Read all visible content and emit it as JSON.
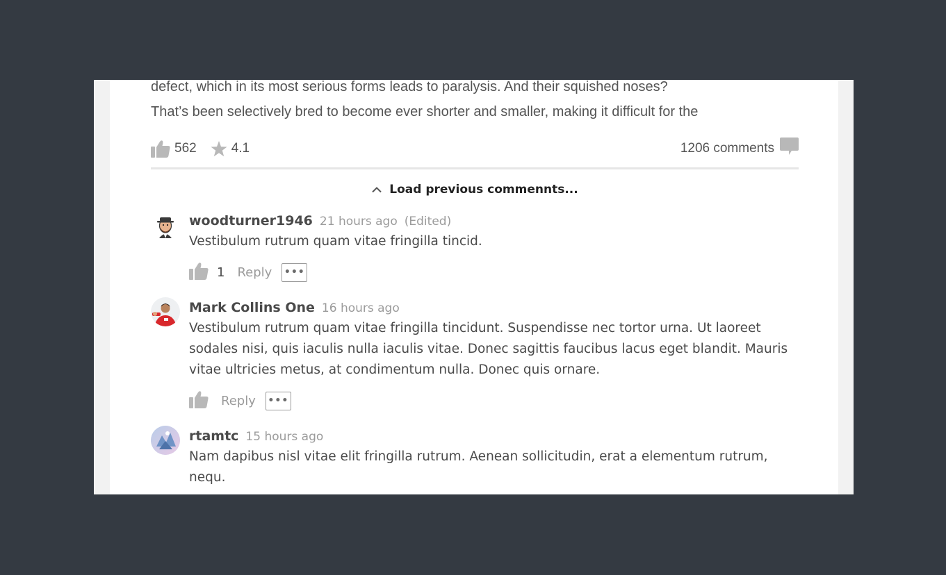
{
  "article": {
    "excerpt_lines": [
      "defect, which in its most serious forms leads to paralysis. And their squished noses?",
      "That’s been selectively bred to become ever shorter and smaller, making it difficult for the"
    ]
  },
  "stats": {
    "likes": "562",
    "rating": "4.1",
    "comments": "1206 comments"
  },
  "load_previous_label": "Load previous commennts...",
  "comments": [
    {
      "author": "woodturner1946",
      "time": "21 hours ago",
      "edited": "(Edited)",
      "text": "Vestibulum rutrum quam vitae fringilla tincid.",
      "likes": "1",
      "reply_label": "Reply",
      "more_label": "•••"
    },
    {
      "author": "Mark Collins One",
      "time": "16 hours ago",
      "text": "Vestibulum rutrum quam vitae fringilla tincidunt. Suspendisse nec tortor urna. Ut laoreet sodales nisi, quis iaculis nulla iaculis vitae. Donec sagittis faucibus lacus eget blandit. Mauris vitae ultricies metus, at condimentum nulla. Donec quis ornare.",
      "reply_label": "Reply",
      "more_label": "•••"
    },
    {
      "author": "rtamtc",
      "time": "15 hours ago",
      "text": "Nam dapibus nisl vitae elit fringilla rutrum. Aenean sollicitudin, erat a elementum rutrum, nequ."
    }
  ],
  "icons": {
    "like": "thumbs-up-icon",
    "star": "star-icon",
    "comments": "comment-bubble-icon",
    "collapse": "chevron-up-icon"
  },
  "colors": {
    "page_background": "#343a42",
    "icon_gray": "#b8b8b8",
    "meta_gray": "#9b9b9b",
    "text": "#4a4a4a"
  }
}
